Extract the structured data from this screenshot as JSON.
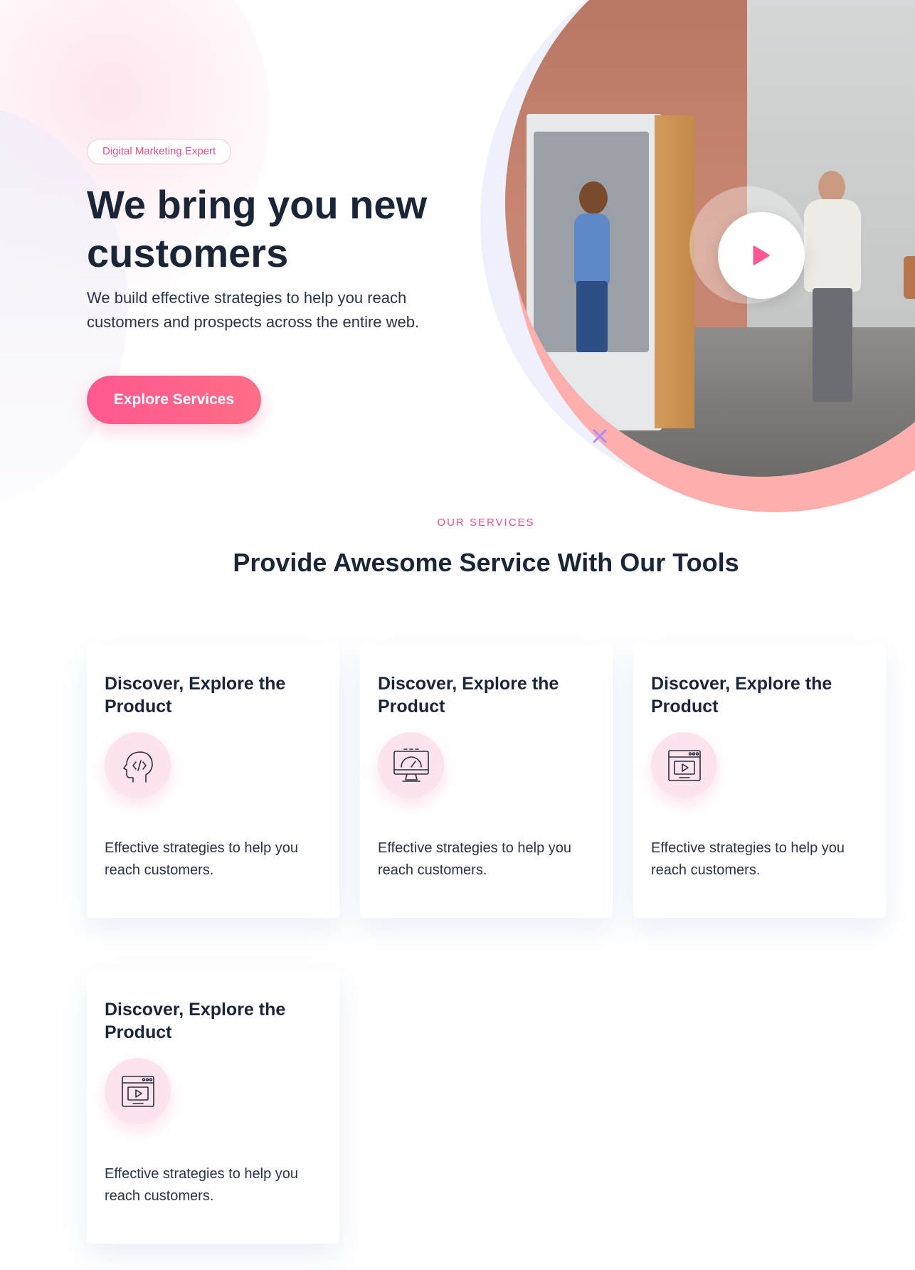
{
  "hero": {
    "badge": "Digital Marketing Expert",
    "title": "We bring you new customers",
    "subtitle": "We build effective strategies to help you reach customers and prospects across the entire web.",
    "cta_label": "Explore Services"
  },
  "services": {
    "eyebrow": "OUR SERVICES",
    "title": "Provide Awesome Service With Our Tools",
    "cards": [
      {
        "title": "Discover, Explore the Product",
        "icon": "code-head-icon",
        "text": "Effective strategies to help you reach customers."
      },
      {
        "title": "Discover, Explore the Product",
        "icon": "monitor-gauge-icon",
        "text": "Effective strategies to help you reach customers."
      },
      {
        "title": "Discover, Explore the Product",
        "icon": "browser-video-icon",
        "text": "Effective strategies to help you reach customers."
      },
      {
        "title": "Discover, Explore the Product",
        "icon": "browser-video-icon",
        "text": "Effective strategies to help you reach customers."
      }
    ]
  },
  "colors": {
    "accent_pink": "#ff5790",
    "heading": "#1b2538",
    "icon_bg": "#fde3ee",
    "salmon": "#ffaeae"
  }
}
